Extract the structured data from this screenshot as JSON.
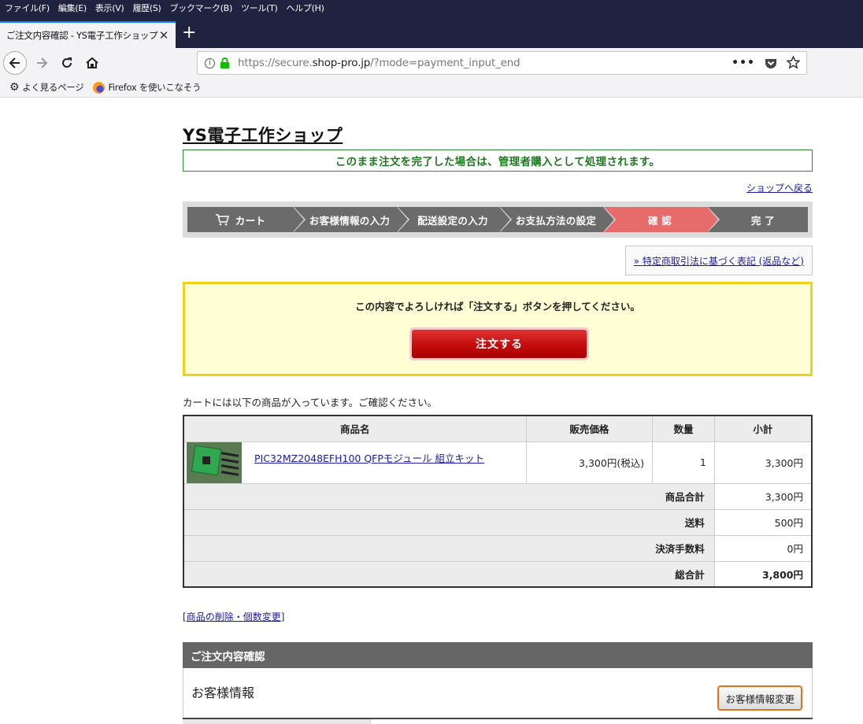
{
  "browser": {
    "menu": [
      "ファイル(F)",
      "編集(E)",
      "表示(V)",
      "履歴(S)",
      "ブックマーク(B)",
      "ツール(T)",
      "ヘルプ(H)"
    ],
    "tab_title": "ご注文内容確認 - YS電子工作ショップ",
    "url_prefix": "https://secure.",
    "url_domain": "shop-pro.jp",
    "url_suffix": "/?mode=payment_input_end",
    "bookmarks": [
      "よく見るページ",
      "Firefox を使いこなそう"
    ]
  },
  "shop": {
    "title": "YS電子工作ショップ",
    "admin_notice": "このまま注文を完了した場合は、管理者購入として処理されます。",
    "back_link": "ショップへ戻る"
  },
  "steps": [
    "カート",
    "お客様情報の入力",
    "配送設定の入力",
    "お支払方法の設定",
    "確 認",
    "完 了"
  ],
  "law_link": "» 特定商取引法に基づく表記 (返品など)",
  "confirm": {
    "message": "この内容でよろしければ「注文する」ボタンを押してください。",
    "button": "注文する"
  },
  "cart": {
    "intro": "カートには以下の商品が入っています。ご確認ください。",
    "headers": [
      "商品名",
      "販売価格",
      "数量",
      "小計"
    ],
    "item": {
      "name": "PIC32MZ2048EFH100 QFPモジュール 組立キット",
      "price": "3,300円(税込)",
      "qty": "1",
      "subtotal": "3,300円"
    },
    "summary": [
      {
        "label": "商品合計",
        "value": "3,300円"
      },
      {
        "label": "送料",
        "value": "500円"
      },
      {
        "label": "決済手数料",
        "value": "0円"
      },
      {
        "label": "総合計",
        "value": "3,800円"
      }
    ]
  },
  "edit_link": "商品の削除・個数変更",
  "order_section": {
    "heading": "ご注文内容確認",
    "customer_title": "お客様情報",
    "customer_button": "お客様情報変更"
  },
  "colors": {
    "step_active": "#e86b6b",
    "step_default": "#6b6b6b",
    "notice_green": "#1e7a1e",
    "confirm_bg": "#ffffd6",
    "confirm_border": "#efd21c",
    "order_button": "#c40c0c"
  }
}
